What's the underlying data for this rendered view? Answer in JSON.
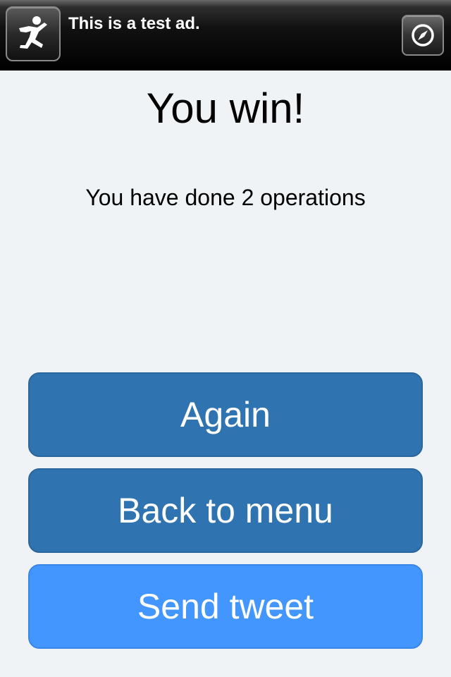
{
  "ad": {
    "text": "This is a test ad.",
    "icon": "running-person-icon",
    "action_icon": "compass-icon"
  },
  "result": {
    "title": "You win!",
    "message": "You have done 2 operations"
  },
  "buttons": {
    "again": "Again",
    "back_to_menu": "Back to menu",
    "send_tweet": "Send tweet"
  },
  "colors": {
    "background": "#eff3f6",
    "primary_button": "#2f74b0",
    "tweet_button": "#4296fe",
    "ad_background": "#000000"
  }
}
